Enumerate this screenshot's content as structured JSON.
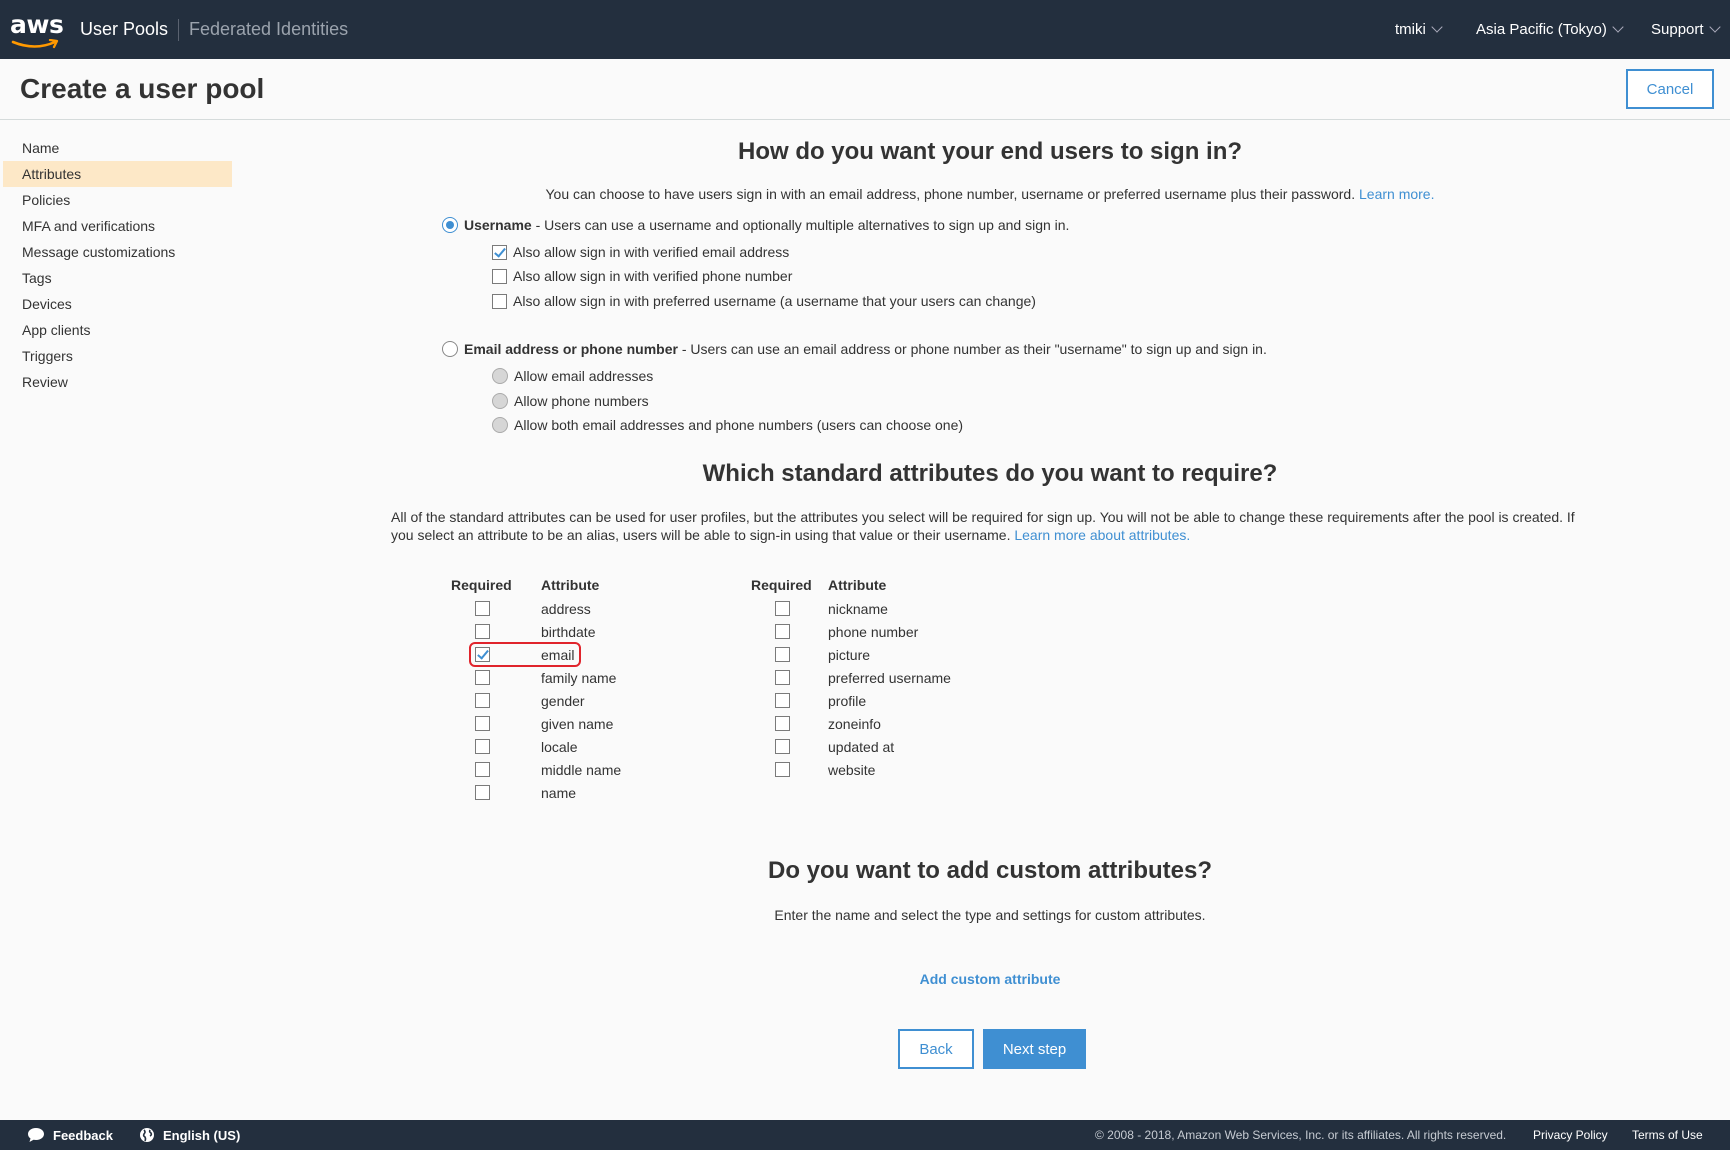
{
  "topbar": {
    "logo": "aws",
    "user_pools": "User Pools",
    "federated": "Federated Identities",
    "user": "tmiki",
    "region": "Asia Pacific (Tokyo)",
    "support": "Support"
  },
  "header": {
    "title": "Create a user pool",
    "cancel": "Cancel"
  },
  "sidebar": {
    "items": [
      {
        "label": "Name"
      },
      {
        "label": "Attributes"
      },
      {
        "label": "Policies"
      },
      {
        "label": "MFA and verifications"
      },
      {
        "label": "Message customizations"
      },
      {
        "label": "Tags"
      },
      {
        "label": "Devices"
      },
      {
        "label": "App clients"
      },
      {
        "label": "Triggers"
      },
      {
        "label": "Review"
      }
    ],
    "active": "Attributes"
  },
  "signin": {
    "title": "How do you want your end users to sign in?",
    "intro": "You can choose to have users sign in with an email address, phone number, username or preferred username plus their password.",
    "learn_more": "Learn more.",
    "username_label": "Username",
    "username_desc": " - Users can use a username and optionally multiple alternatives to sign up and sign in.",
    "username_options": [
      "Also allow sign in with verified email address",
      "Also allow sign in with verified phone number",
      "Also allow sign in with preferred username (a username that your users can change)"
    ],
    "email_label": "Email address or phone number",
    "email_desc": " - Users can use an email address or phone number as their \"username\" to sign up and sign in.",
    "email_options": [
      "Allow email addresses",
      "Allow phone numbers",
      "Allow both email addresses and phone numbers (users can choose one)"
    ]
  },
  "standard": {
    "title": "Which standard attributes do you want to require?",
    "desc": "All of the standard attributes can be used for user profiles, but the attributes you select will be required for sign up. You will not be able to change these requirements after the pool is created. If you select an attribute to be an alias, users will be able to sign-in using that value or their username.",
    "learn_more": "Learn more about attributes.",
    "col_required": "Required",
    "col_attribute": "Attribute",
    "left_attrs": [
      "address",
      "birthdate",
      "email",
      "family name",
      "gender",
      "given name",
      "locale",
      "middle name",
      "name"
    ],
    "right_attrs": [
      "nickname",
      "phone number",
      "picture",
      "preferred username",
      "profile",
      "zoneinfo",
      "updated at",
      "website"
    ]
  },
  "custom": {
    "title": "Do you want to add custom attributes?",
    "desc": "Enter the name and select the type and settings for custom attributes.",
    "add": "Add custom attribute"
  },
  "buttons": {
    "back": "Back",
    "next": "Next step"
  },
  "footer": {
    "feedback": "Feedback",
    "language": "English (US)",
    "copyright": "© 2008 - 2018, Amazon Web Services, Inc. or its affiliates. All rights reserved.",
    "privacy": "Privacy Policy",
    "terms": "Terms of Use"
  },
  "colors": {
    "nav": "#232f3e",
    "accent": "#3f8fd2",
    "active_nav": "#fde8c7",
    "highlight": "#e0242c"
  }
}
